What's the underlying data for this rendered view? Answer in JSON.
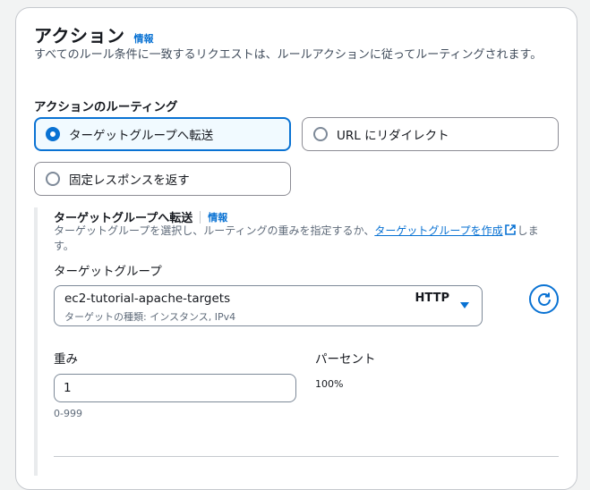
{
  "header": {
    "title": "アクション",
    "info_label": "情報",
    "description": "すべてのルール条件に一致するリクエストは、ルールアクションに従ってルーティングされます。"
  },
  "routing": {
    "label": "アクションのルーティング",
    "options": [
      {
        "label": "ターゲットグループへ転送",
        "selected": true
      },
      {
        "label": "URL にリダイレクト",
        "selected": false
      },
      {
        "label": "固定レスポンスを返す",
        "selected": false
      }
    ]
  },
  "forward": {
    "title": "ターゲットグループへ転送",
    "info_label": "情報",
    "desc_before": "ターゲットグループを選択し、ルーティングの重みを指定するか、",
    "create_link": "ターゲットグループを作成",
    "desc_after": "します。",
    "target_group_label": "ターゲットグループ",
    "selected_group": "ec2-tutorial-apache-targets",
    "selected_group_meta": "ターゲットの種類: インスタンス, IPv4",
    "protocol": "HTTP",
    "weight_label": "重み",
    "weight_value": "1",
    "weight_hint": "0-999",
    "percent_label": "パーセント",
    "percent_value": "100%"
  },
  "icons": {
    "refresh": "refresh-icon",
    "external": "external-link-icon",
    "caret": "caret-down-icon"
  },
  "colors": {
    "accent": "#0972d3",
    "selected_bg": "#f1faff"
  }
}
